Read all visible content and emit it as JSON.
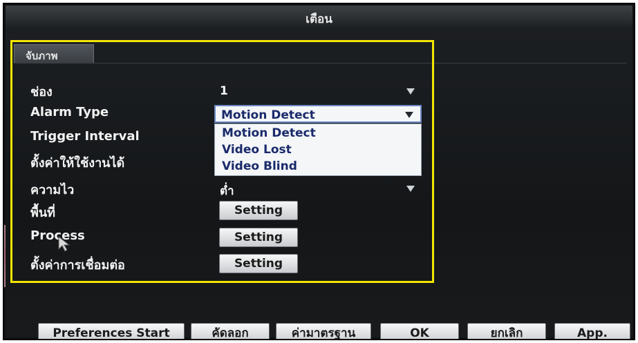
{
  "window": {
    "title": "เตือน"
  },
  "tab": {
    "label": "จับภาพ"
  },
  "fields": {
    "channel": {
      "label": "ช่อง",
      "value": "1"
    },
    "alarm_type": {
      "label": "Alarm Type",
      "value": "Motion Detect",
      "options": [
        "Motion Detect",
        "Video Lost",
        "Video Blind"
      ]
    },
    "trigger_interval": {
      "label": "Trigger Interval"
    },
    "enable": {
      "label": "ตั้งค่าให้ใช้งานได้"
    },
    "sensitivity": {
      "label": "ความไว",
      "value": "ต่ำ"
    },
    "area": {
      "label": "พื้นที่",
      "button": "Setting"
    },
    "process": {
      "label": "Process",
      "button": "Setting"
    },
    "connection": {
      "label": "ตั้งค่าการเชื่อมต่อ",
      "button": "Setting"
    }
  },
  "bottom_buttons": {
    "preferences_start": "Preferences Start",
    "copy": "คัดลอก",
    "default": "ค่ามาตรฐาน",
    "ok": "OK",
    "cancel": "ยกเลิก",
    "apply": "App."
  },
  "colors": {
    "highlight_box": "#f2e600",
    "background": "#141618",
    "selected_text": "#1a2a6a"
  },
  "icons": [
    "mouse-pointer-icon",
    "dropdown-arrow-icon"
  ]
}
